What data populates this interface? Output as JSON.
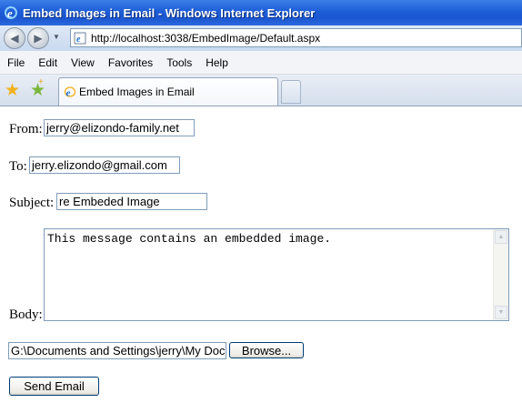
{
  "window": {
    "title": "Embed Images in Email - Windows Internet Explorer",
    "url": "http://localhost:3038/EmbedImage/Default.aspx"
  },
  "menu": [
    "File",
    "Edit",
    "View",
    "Favorites",
    "Tools",
    "Help"
  ],
  "tab": {
    "label": "Embed Images in Email"
  },
  "form": {
    "from_label": "From:",
    "from_value": "jerry@elizondo-family.net",
    "to_label": "To:",
    "to_value": "jerry.elizondo@gmail.com",
    "subject_label": "Subject:",
    "subject_value": "re Embeded Image",
    "body_label": "Body:",
    "body_value": "This message contains an embedded image.",
    "file_value": "G:\\Documents and Settings\\jerry\\My Doc",
    "browse_label": "Browse...",
    "send_label": "Send Email"
  },
  "icons": {
    "back": "back-arrow-icon",
    "forward": "forward-arrow-icon",
    "favorites": "favorites-star-icon",
    "add_favorites": "add-favorites-icon",
    "page": "ie-page-icon"
  },
  "colors": {
    "titlebar": "#1d5dd8",
    "input_border": "#7f9db9",
    "button_border": "#003c74"
  }
}
